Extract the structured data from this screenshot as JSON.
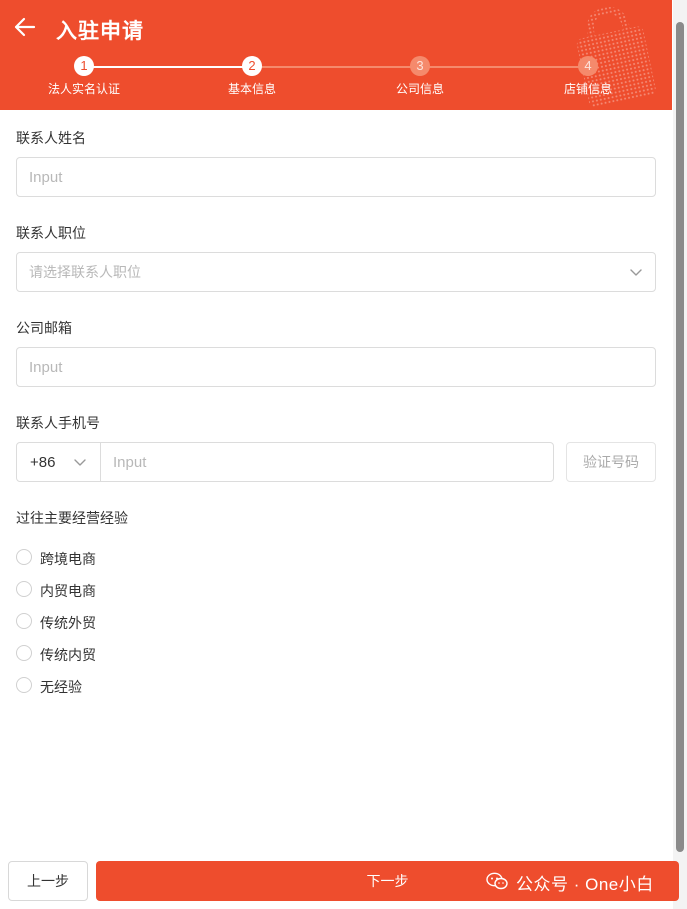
{
  "header": {
    "title": "入驻申请",
    "back_icon": "arrow-left-icon",
    "decoration_icon": "shopping-bag-icon"
  },
  "steps": [
    {
      "number": "1",
      "label": "法人实名认证",
      "done": true
    },
    {
      "number": "2",
      "label": "基本信息",
      "done": true
    },
    {
      "number": "3",
      "label": "公司信息",
      "done": false
    },
    {
      "number": "4",
      "label": "店铺信息",
      "done": false
    }
  ],
  "form": {
    "contact_name": {
      "label": "联系人姓名",
      "placeholder": "Input"
    },
    "contact_position": {
      "label": "联系人职位",
      "placeholder": "请选择联系人职位"
    },
    "company_email": {
      "label": "公司邮箱",
      "placeholder": "Input"
    },
    "contact_phone": {
      "label": "联系人手机号",
      "country_code": "+86",
      "placeholder": "Input",
      "verify_button": "验证号码"
    },
    "experience": {
      "label": "过往主要经营经验",
      "options": [
        "跨境电商",
        "内贸电商",
        "传统外贸",
        "传统内贸",
        "无经验"
      ]
    }
  },
  "footer": {
    "prev_label": "上一步",
    "next_label": "下一步",
    "watermark": "公众号 · One小白"
  },
  "colors": {
    "accent": "#ee4d2d",
    "step_pending": "#f58a6c"
  }
}
